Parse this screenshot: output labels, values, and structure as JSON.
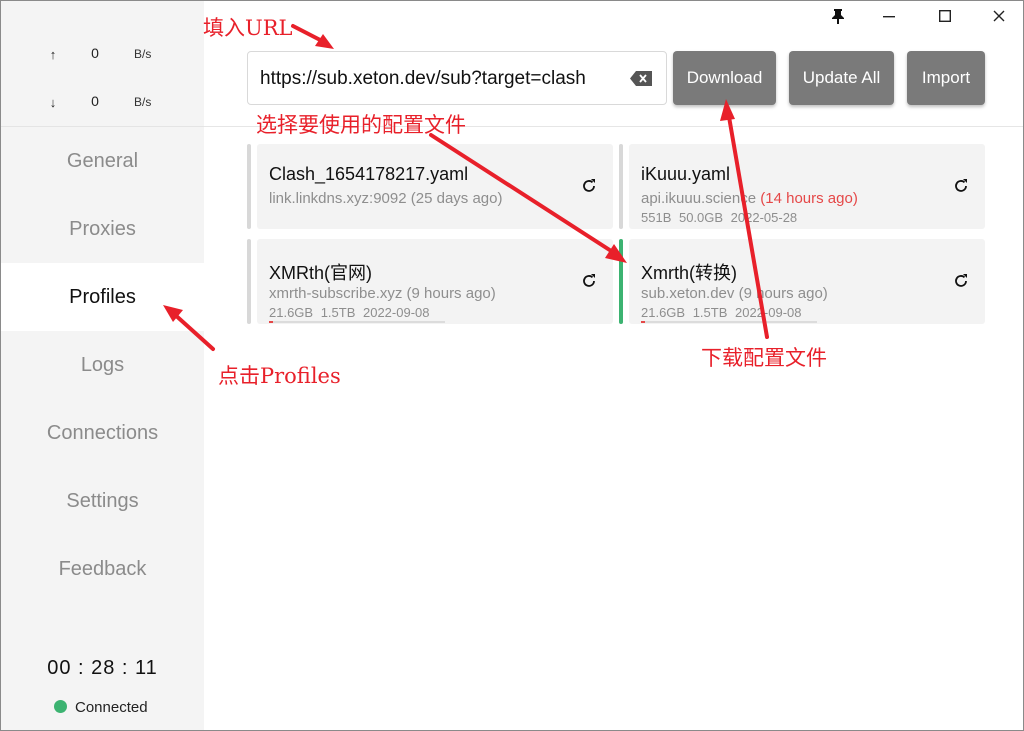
{
  "window": {
    "controls": {
      "pin": "📌",
      "minimize": "—",
      "maximize": "▢",
      "close": "✕"
    }
  },
  "sidebar": {
    "traffic": {
      "up": {
        "arrow": "↑",
        "value": "0",
        "unit": "B/s"
      },
      "down": {
        "arrow": "↓",
        "value": "0",
        "unit": "B/s"
      }
    },
    "nav": [
      {
        "label": "General"
      },
      {
        "label": "Proxies"
      },
      {
        "label": "Profiles"
      },
      {
        "label": "Logs"
      },
      {
        "label": "Connections"
      },
      {
        "label": "Settings"
      },
      {
        "label": "Feedback"
      }
    ],
    "timer": "00 : 28 : 11",
    "status": "Connected"
  },
  "toolbar": {
    "url_value": "https://sub.xeton.dev/sub?target=clash",
    "download_label": "Download",
    "update_all_label": "Update All",
    "import_label": "Import"
  },
  "profiles": [
    {
      "name": "Clash_1654178217.yaml",
      "source": "link.linkdns.xyz:9092",
      "age": "(25 days ago)",
      "age_highlight": false,
      "meta": ""
    },
    {
      "name": "iKuuu.yaml",
      "source": "api.ikuuu.science",
      "age": "(14 hours ago)",
      "age_highlight": true,
      "meta": "551B  50.0GB  2022-05-28",
      "progress": 0
    },
    {
      "name": "XMRth(官网)",
      "source": "xmrth-subscribe.xyz",
      "age": "(9 hours ago)",
      "age_highlight": false,
      "meta": "21.6GB  1.5TB  2022-09-08",
      "progress": 0.02
    },
    {
      "name": "Xmrth(转换)",
      "source": "sub.xeton.dev",
      "age": "(9 hours ago)",
      "age_highlight": false,
      "meta": "21.6GB  1.5TB  2022-09-08",
      "progress": 0.02
    }
  ],
  "annotations": {
    "fill_url": "填入URL",
    "select_profile": "选择要使用的配置文件",
    "click_profiles": "点击Profiles",
    "download_profile": "下载配置文件"
  },
  "colors": {
    "accent_red": "#e8202a",
    "connected_green": "#3cb371",
    "button_gray": "#7a7a7a"
  }
}
